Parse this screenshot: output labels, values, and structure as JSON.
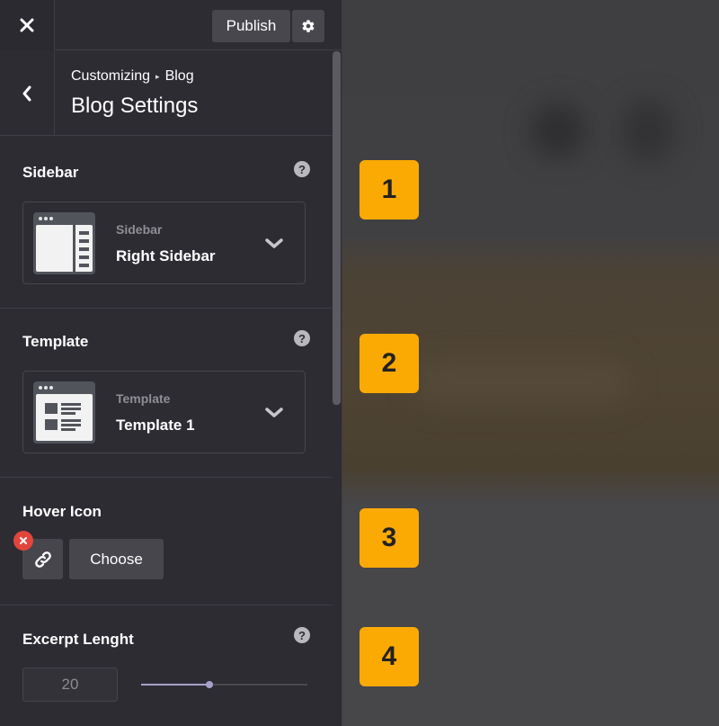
{
  "topbar": {
    "close_icon": "close-icon",
    "publish_label": "Publish",
    "settings_icon": "gear-icon"
  },
  "header": {
    "back_icon": "chevron-left-icon",
    "breadcrumb": {
      "root": "Customizing",
      "separator": "▸",
      "current": "Blog"
    },
    "title": "Blog Settings"
  },
  "sections": {
    "sidebar": {
      "title": "Sidebar",
      "help_icon": "help-icon",
      "select_label": "Sidebar",
      "select_value": "Right Sidebar"
    },
    "template": {
      "title": "Template",
      "help_icon": "help-icon",
      "select_label": "Template",
      "select_value": "Template 1"
    },
    "hover_icon": {
      "title": "Hover Icon",
      "icon": "link-icon",
      "remove_icon": "close-icon",
      "choose_label": "Choose"
    },
    "excerpt": {
      "title": "Excerpt Lenght",
      "help_icon": "help-icon",
      "value": "20",
      "slider_fraction": 0.41
    }
  },
  "callouts": [
    "1",
    "2",
    "3",
    "4"
  ],
  "colors": {
    "panel_bg": "#2d2c33",
    "callout": "#fbaa04",
    "remove": "#e2453c",
    "slider": "#a7a1c9"
  }
}
